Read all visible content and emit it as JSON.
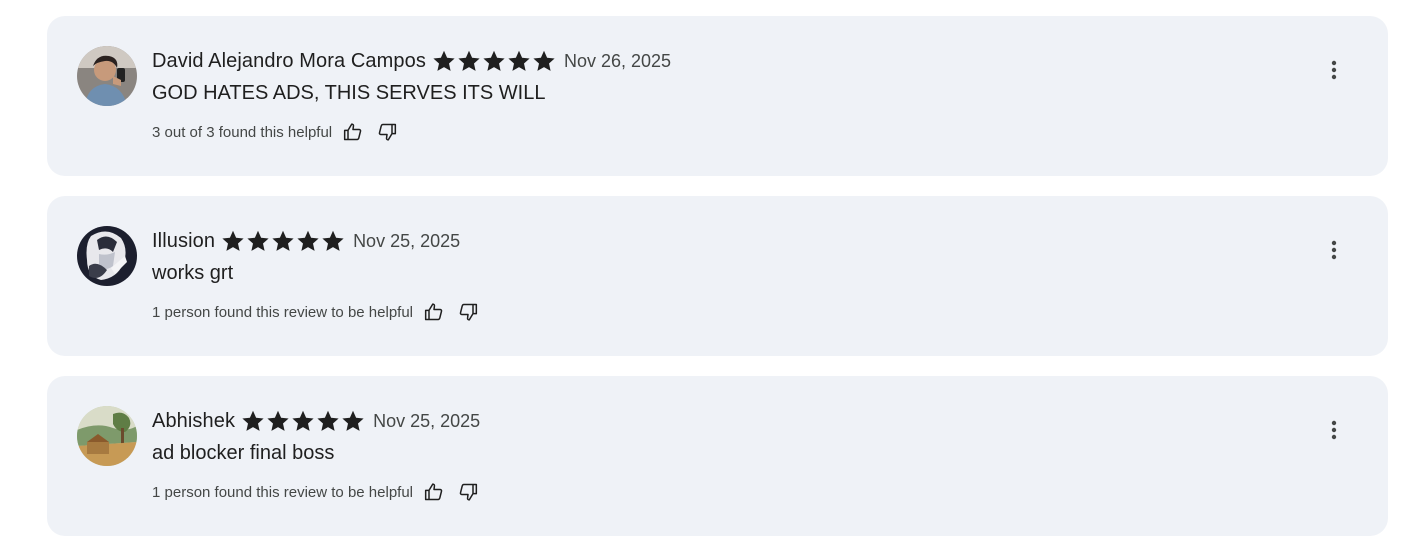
{
  "reviews": [
    {
      "author": "David Alejandro Mora Campos",
      "rating": 5,
      "date": "Nov 26, 2025",
      "text": "GOD HATES ADS, THIS SERVES ITS WILL",
      "helpful": "3 out of 3 found this helpful",
      "avatar_icon": "avatar-photo"
    },
    {
      "author": "Illusion",
      "rating": 5,
      "date": "Nov 25, 2025",
      "text": "works grt",
      "helpful": "1 person found this review to be helpful",
      "avatar_icon": "avatar-photo"
    },
    {
      "author": "Abhishek",
      "rating": 5,
      "date": "Nov 25, 2025",
      "text": "ad blocker final boss",
      "helpful": "1 person found this review to be helpful",
      "avatar_icon": "avatar-photo"
    }
  ],
  "icons": {
    "star": "star-icon",
    "thumbs_up": "thumbs-up-icon",
    "thumbs_down": "thumbs-down-icon",
    "more": "more-vert-icon"
  },
  "colors": {
    "card_background": "#eff2f7",
    "star": "#1f1f1f",
    "text_primary": "#1f1f1f",
    "text_secondary": "#444746"
  }
}
